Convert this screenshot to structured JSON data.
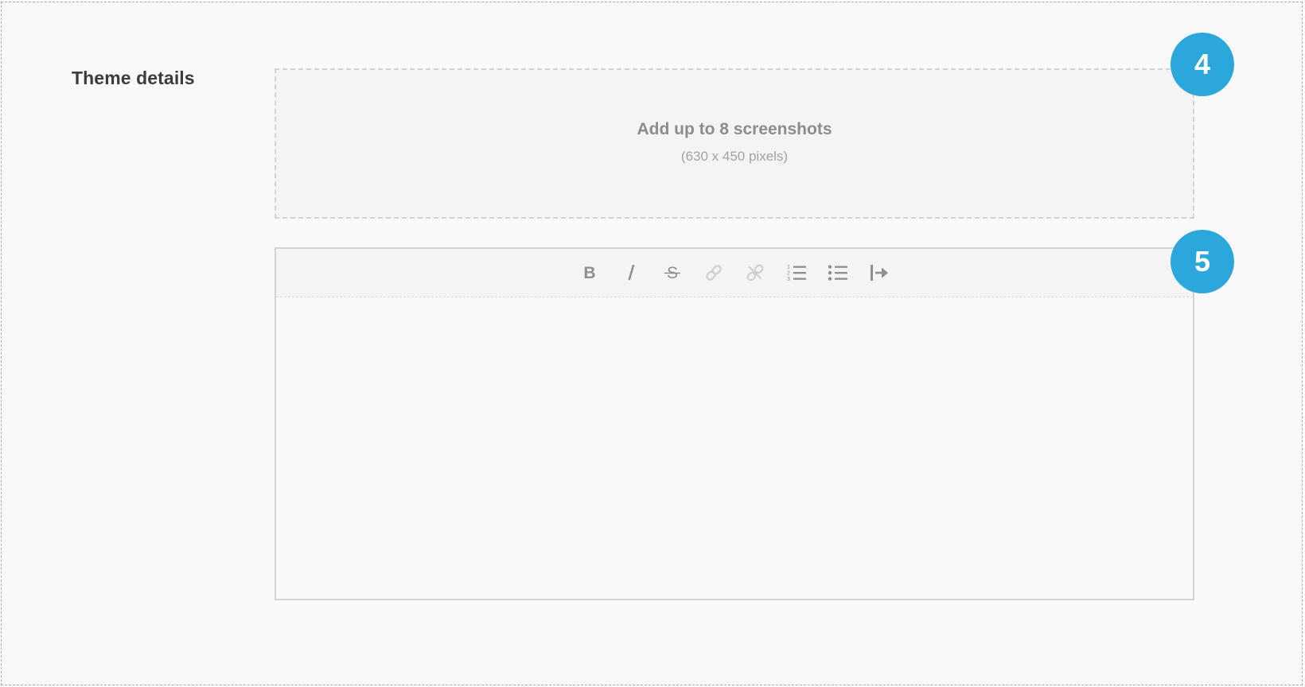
{
  "section": {
    "title": "Theme details"
  },
  "screenshots": {
    "title": "Add up to 8 screenshots",
    "subtitle": "(630 x 450 pixels)"
  },
  "editor": {
    "toolbar": [
      {
        "name": "bold",
        "icon": "bold-icon"
      },
      {
        "name": "italic",
        "icon": "italic-icon"
      },
      {
        "name": "strikethrough",
        "icon": "strikethrough-icon"
      },
      {
        "name": "link",
        "icon": "link-icon",
        "disabled": true
      },
      {
        "name": "unlink",
        "icon": "unlink-icon",
        "disabled": true
      },
      {
        "name": "ordered-list",
        "icon": "ordered-list-icon"
      },
      {
        "name": "bullet-list",
        "icon": "bullet-list-icon"
      },
      {
        "name": "indent",
        "icon": "indent-icon"
      }
    ],
    "value": ""
  },
  "badges": {
    "first": "4",
    "second": "5"
  },
  "colors": {
    "accent": "#2ba7dc",
    "icon_active": "#8e8e8e",
    "icon_disabled": "#cfcfcf"
  }
}
